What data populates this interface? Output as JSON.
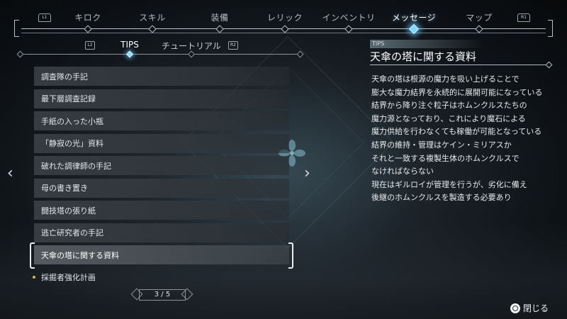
{
  "nav": {
    "left_hint": "L1",
    "right_hint": "R1",
    "tabs": [
      {
        "label": "キロク",
        "active": false
      },
      {
        "label": "スキル",
        "active": false
      },
      {
        "label": "装備",
        "active": false
      },
      {
        "label": "レリック",
        "active": false
      },
      {
        "label": "インベントリ",
        "active": false
      },
      {
        "label": "メッセージ",
        "active": true
      },
      {
        "label": "マップ",
        "active": false
      }
    ]
  },
  "subtabs": {
    "left_hint": "L2",
    "right_hint": "R2",
    "items": [
      {
        "label": "TIPS",
        "active": true
      },
      {
        "label": "チュートリアル",
        "active": false
      }
    ]
  },
  "list": {
    "items": [
      {
        "label": "調査隊の手記"
      },
      {
        "label": "最下層調査記録"
      },
      {
        "label": "手紙の入った小瓶"
      },
      {
        "label": "「静寂の光」資料"
      },
      {
        "label": "破れた調律師の手記"
      },
      {
        "label": "母の書き置き"
      },
      {
        "label": "闘技塔の張り紙"
      },
      {
        "label": "逃亡研究者の手記"
      },
      {
        "label": "天傘の塔に関する資料",
        "selected": true
      },
      {
        "label": "採掘者強化計画",
        "new": true
      }
    ]
  },
  "pager": {
    "text": "3 / 5"
  },
  "panel": {
    "tag": "TIPS",
    "title": "天傘の塔に関する資料",
    "lines": [
      "天傘の塔は根源の魔力を吸い上げることで",
      "膨大な魔力結界を永続的に展開可能になっている",
      "結界から降り注ぐ粒子はホムンクルスたちの",
      "魔力源となっており、これにより魔石による",
      "魔力供給を行わなくても稼働が可能となっている",
      "結界の維持・管理はケイン・ミリアスか",
      "それと一致する複製生体のホムンクルスで",
      "なければならない",
      "現在はギルロイが管理を行うが、劣化に備え",
      "後継のホムンクルスを製造する必要あり"
    ]
  },
  "close": {
    "label": "閉じる"
  },
  "colors": {
    "accent": "#7fd6ff",
    "new_dot": "#e0b34a"
  }
}
